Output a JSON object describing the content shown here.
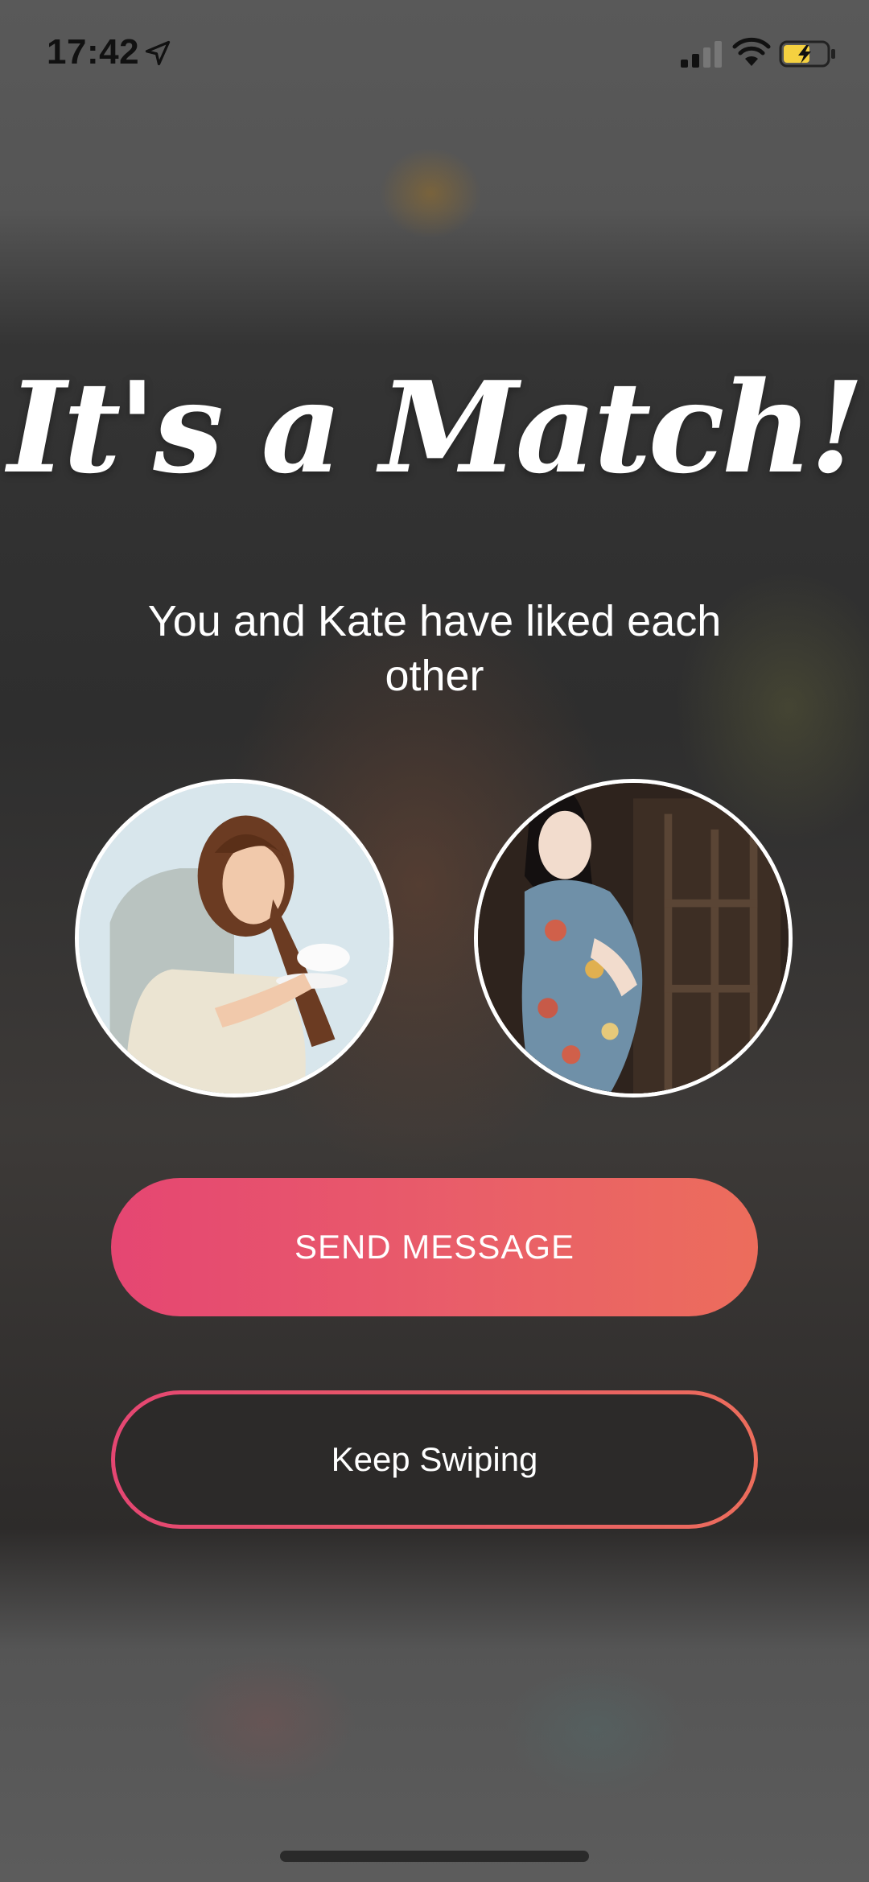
{
  "status_bar": {
    "time": "17:42",
    "icons": [
      "location-arrow-icon",
      "cellular-signal-icon",
      "wifi-icon",
      "battery-charging-icon"
    ]
  },
  "match": {
    "title": "It's a Match!",
    "subtitle": "You and Kate have liked each other"
  },
  "avatars": {
    "left": "user-photo",
    "right": "match-photo-kate"
  },
  "buttons": {
    "send_message": "SEND MESSAGE",
    "keep_swiping": "Keep Swiping"
  },
  "colors": {
    "accent_start": "#e54672",
    "accent_end": "#ec6d5c",
    "battery": "#f5d140"
  }
}
